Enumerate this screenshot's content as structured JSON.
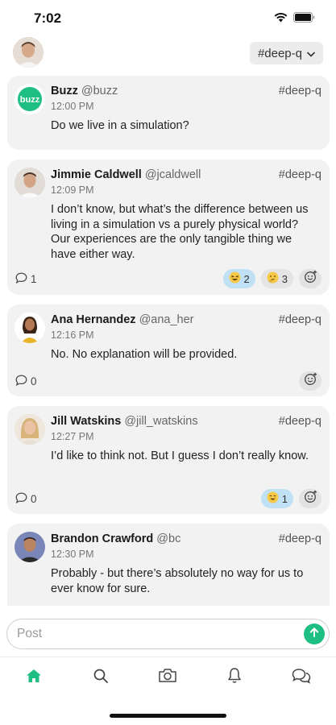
{
  "status_bar": {
    "time": "7:02"
  },
  "header": {
    "channel": "#deep-q"
  },
  "posts": [
    {
      "name": "Buzz",
      "handle": "@buzz",
      "time": "12:00 PM",
      "channel": "#deep-q",
      "body": "Do we live in a simulation?",
      "avatar_text": "buzz"
    },
    {
      "name": "Jimmie Caldwell",
      "handle": "@jcaldwell",
      "time": "12:09 PM",
      "channel": "#deep-q",
      "body": "I don’t know, but what’s the difference between us living in a simulation vs a purely physical world? Our experiences are the only tangible thing we have either way.",
      "comments": "1",
      "reactions": [
        {
          "emoji": "laughing-face",
          "count": "2",
          "active": true
        },
        {
          "emoji": "thinking-face",
          "count": "3",
          "active": false
        }
      ]
    },
    {
      "name": "Ana Hernandez",
      "handle": "@ana_her",
      "time": "12:16 PM",
      "channel": "#deep-q",
      "body": "No. No explanation will be provided.",
      "comments": "0"
    },
    {
      "name": "Jill Watskins",
      "handle": "@jill_watskins",
      "time": "12:27 PM",
      "channel": "#deep-q",
      "body": "I’d like to think not. But I guess I don’t really know.",
      "comments": "0",
      "reactions": [
        {
          "emoji": "grinning-face",
          "count": "1",
          "active": true
        }
      ]
    },
    {
      "name": "Brandon Crawford",
      "handle": "@bc",
      "time": "12:30 PM",
      "channel": "#deep-q",
      "body": "Probably - but there’s absolutely no way for us to ever know for sure."
    }
  ],
  "composer": {
    "placeholder": "Post"
  },
  "tabs": [
    "home-icon",
    "search-icon",
    "camera-icon",
    "bell-icon",
    "chat-icon"
  ],
  "colors": {
    "accent": "#1fbf83",
    "card": "#f2f2f2",
    "reaction_active": "#bfe0f5"
  }
}
